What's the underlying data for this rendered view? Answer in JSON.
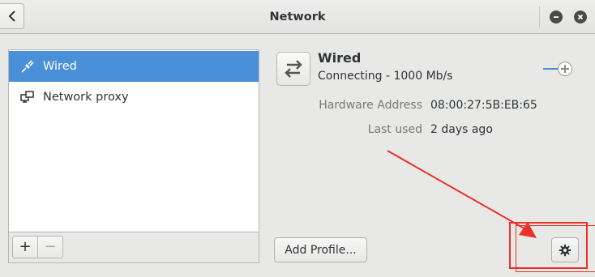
{
  "window": {
    "title": "Network"
  },
  "header": {
    "back_icon": "chevron-left-icon",
    "minimize_icon": "minimize-icon",
    "close_icon": "close-icon"
  },
  "devices": [
    {
      "label": "Wired",
      "icon": "ethernet-icon",
      "selected": true
    },
    {
      "label": "Network proxy",
      "icon": "network-proxy-icon",
      "selected": false
    }
  ],
  "list_toolbar": {
    "add_label": "+",
    "remove_label": "−"
  },
  "connection": {
    "name": "Wired",
    "status": "Connecting - 1000 Mb/s",
    "icon": "swap-arrows-icon",
    "enabled": true,
    "properties": [
      {
        "label": "Hardware Address",
        "value": "08:00:27:5B:EB:65"
      },
      {
        "label": "Last used",
        "value": "2 days ago"
      }
    ]
  },
  "actions": {
    "add_profile_label": "Add Profile...",
    "settings_icon": "gear-icon"
  },
  "colors": {
    "selection": "#4a90d9",
    "annotation": "#e8322a",
    "background": "#e8e8e7"
  }
}
